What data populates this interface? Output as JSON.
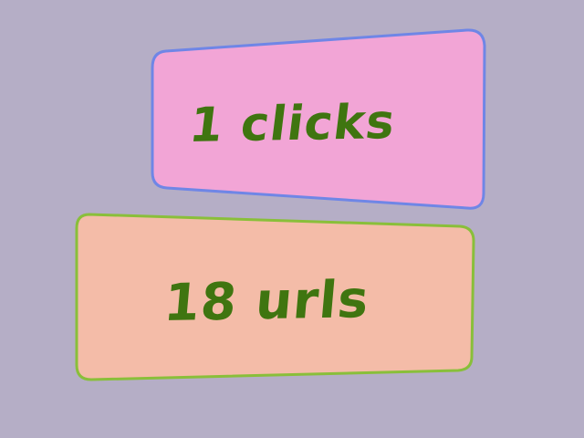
{
  "cards": [
    {
      "text": "1 clicks",
      "fill": "#f2a5d6",
      "border": "#6f86e6"
    },
    {
      "text": "18 urls",
      "fill": "#f4bca8",
      "border": "#89bf3a"
    }
  ],
  "colors": {
    "background": "#b5aec6",
    "text": "#3f7510"
  }
}
